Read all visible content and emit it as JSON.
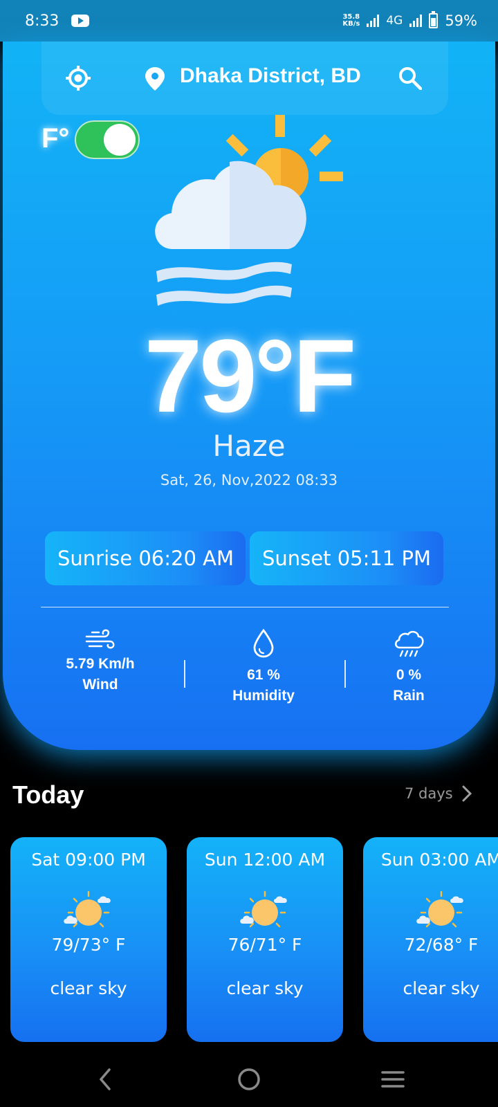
{
  "status_bar": {
    "time": "8:33",
    "net_speed_value": "35.8",
    "net_speed_unit": "KB/s",
    "network_type": "4G",
    "battery": "59%"
  },
  "header": {
    "location": "Dhaka District, BD",
    "unit_label": "F°",
    "unit_toggle_on": true
  },
  "current": {
    "temperature": "79°F",
    "condition": "Haze",
    "datetime": "Sat, 26, Nov,2022 08:33",
    "sunrise": "Sunrise 06:20 AM",
    "sunset": "Sunset 05:11 PM",
    "wind_value": "5.79 Km/h",
    "wind_label": "Wind",
    "humidity_value": "61 %",
    "humidity_label": "Humidity",
    "rain_value": "0 %",
    "rain_label": "Rain"
  },
  "today": {
    "title": "Today",
    "link_label": "7 days",
    "forecast": [
      {
        "time": "Sat 09:00 PM",
        "temp_range": "79/73° F",
        "desc": "clear sky",
        "icon": "sun-cloud-icon"
      },
      {
        "time": "Sun 12:00 AM",
        "temp_range": "76/71° F",
        "desc": "clear sky",
        "icon": "sun-cloud-icon"
      },
      {
        "time": "Sun 03:00 AM",
        "temp_range": "72/68° F",
        "desc": "clear sky",
        "icon": "sun-cloud-icon"
      }
    ]
  },
  "colors": {
    "accent": "#1490f6",
    "toggle_on": "#2fc25b",
    "sun": "#fbbd3c"
  },
  "nav": {
    "back_icon": "back-icon",
    "home_icon": "home-icon",
    "menu_icon": "menu-icon"
  }
}
